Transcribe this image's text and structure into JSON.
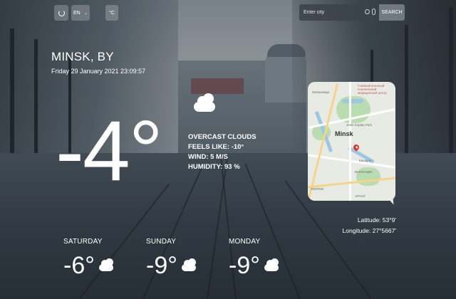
{
  "controls": {
    "refresh_icon": "refresh-icon",
    "language": "EN",
    "unit": "°C"
  },
  "search": {
    "placeholder": "Enter city",
    "button_label": "SEARCH"
  },
  "location": {
    "city": "MINSK, BY",
    "datetime": "Friday 29 January 2021 23:09:57"
  },
  "current": {
    "temperature": "-4°",
    "icon": "cloud-icon",
    "description": "OVERCAST CLOUDS",
    "feels_like": "FEELS LIKE: -10°",
    "wind": "WIND: 5 M/S",
    "humidity": "HUMIDITY: 93 %"
  },
  "map": {
    "city_label": "Minsk",
    "labels": [
      "Главный военный клинический медицинский центр",
      "Zaslauskaja",
      "Janki Kupaly Park",
      "Кашары",
      "ВАСНОЦВА",
      "УБОРКИ",
      "АРАНУ"
    ]
  },
  "coordinates": {
    "latitude": "Latitude: 53°9'",
    "longitude": "Longitude: 27°5667'"
  },
  "forecast": [
    {
      "day": "SATURDAY",
      "temp": "-6°",
      "icon": "cloud-icon"
    },
    {
      "day": "SUNDAY",
      "temp": "-9°",
      "icon": "cloud-icon"
    },
    {
      "day": "MONDAY",
      "temp": "-9°",
      "icon": "cloud-icon"
    }
  ]
}
